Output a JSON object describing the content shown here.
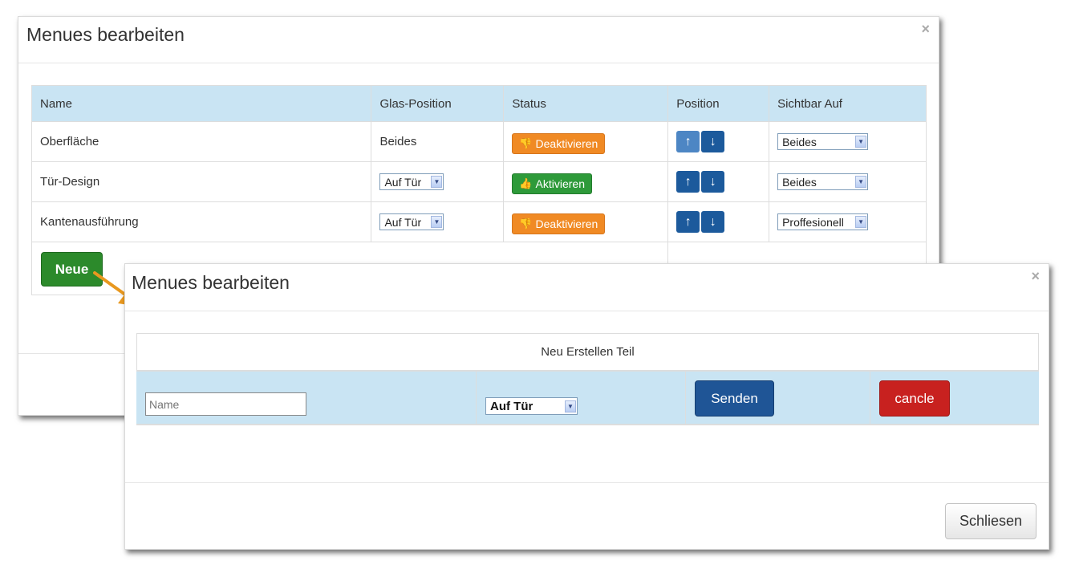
{
  "back_modal": {
    "title": "Menues bearbeiten",
    "close": "×",
    "columns": [
      "Name",
      "Glas-Position",
      "Status",
      "Position",
      "Sichtbar Auf"
    ],
    "rows": [
      {
        "name": "Oberfläche",
        "glas_text": "Beides",
        "status": "Deaktivieren",
        "sichtbar": "Beides"
      },
      {
        "name": "Tür-Design",
        "glas_select": "Auf Tür",
        "status": "Aktivieren",
        "sichtbar": "Beides"
      },
      {
        "name": "Kantenausführung",
        "glas_select": "Auf Tür",
        "status": "Deaktivieren",
        "sichtbar": "Proffesionell"
      }
    ],
    "neue_button": "Neue"
  },
  "front_modal": {
    "title": "Menues bearbeiten",
    "close": "×",
    "section_title": "Neu Erstellen Teil",
    "name_placeholder": "Name",
    "position_select": "Auf Tür",
    "senden_button": "Senden",
    "cancle_button": "cancle",
    "schliesen_button": "Schliesen"
  },
  "icons": {
    "up": "arrow-up-icon",
    "down": "arrow-down-icon",
    "thumb_down": "thumbs-down-icon",
    "thumb_up": "thumbs-up-icon",
    "dropdown": "chevron-down-icon"
  },
  "colors": {
    "header_bg": "#c9e4f3",
    "deaktivieren": "#f08a24",
    "aktivieren": "#2e9a3a",
    "primary": "#1f5596",
    "danger": "#c8211f",
    "success": "#2c8a2b",
    "arrow_connector": "#e8981f"
  }
}
